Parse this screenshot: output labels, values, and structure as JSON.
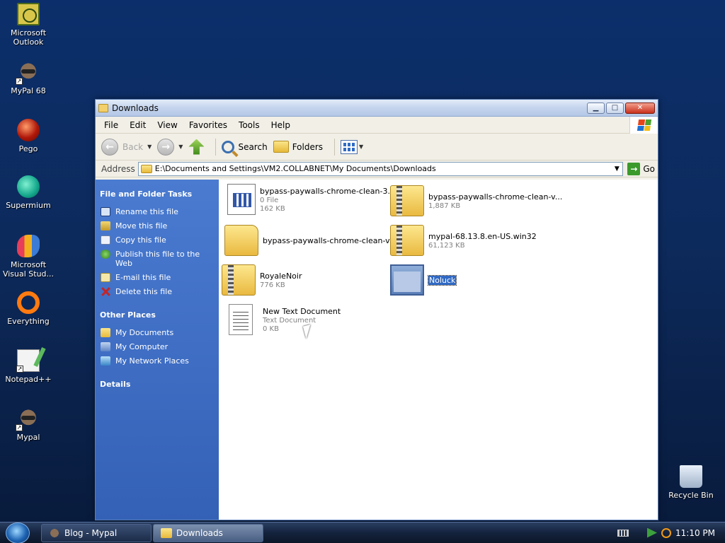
{
  "desktop": {
    "icons": [
      {
        "label": "Microsoft Outlook",
        "icon": "outlook-icon"
      },
      {
        "label": "MyPal 68",
        "icon": "mypal-icon"
      },
      {
        "label": "Pego",
        "icon": "pego-icon"
      },
      {
        "label": "Supermium",
        "icon": "supermium-icon"
      },
      {
        "label": "Microsoft Visual Stud...",
        "icon": "visual-studio-icon"
      },
      {
        "label": "Everything",
        "icon": "everything-icon"
      },
      {
        "label": "Notepad++",
        "icon": "notepadpp-icon"
      },
      {
        "label": "Mypal",
        "icon": "mypal-icon"
      }
    ],
    "recycle_bin": "Recycle Bin"
  },
  "window": {
    "title": "Downloads",
    "menu": [
      "File",
      "Edit",
      "View",
      "Favorites",
      "Tools",
      "Help"
    ],
    "toolbar": {
      "back": "Back",
      "search": "Search",
      "folders": "Folders"
    },
    "address": {
      "label": "Address",
      "path": "E:\\Documents and Settings\\VM2.COLLABNET\\My Documents\\Downloads",
      "go": "Go"
    },
    "taskpane": {
      "file_tasks_title": "File and Folder Tasks",
      "file_tasks": [
        "Rename this file",
        "Move this file",
        "Copy this file",
        "Publish this file to the Web",
        "E-mail this file",
        "Delete this file"
      ],
      "other_places_title": "Other Places",
      "other_places": [
        "My Documents",
        "My Computer",
        "My Network Places"
      ],
      "details_title": "Details"
    },
    "files": [
      {
        "name": "bypass-paywalls-chrome-clean-3....",
        "line1": "0 File",
        "line2": "162 KB",
        "icon": "ini-file-icon"
      },
      {
        "name": "bypass-paywalls-chrome-clean-v...",
        "line1": "1,887 KB",
        "line2": "",
        "icon": "zip-folder-icon"
      },
      {
        "name": "bypass-paywalls-chrome-clean-v...",
        "line1": "",
        "line2": "",
        "icon": "folder-icon"
      },
      {
        "name": "mypal-68.13.8.en-US.win32",
        "line1": "61,123 KB",
        "line2": "",
        "icon": "zip-folder-icon"
      },
      {
        "name": "RoyaleNoir",
        "line1": "776 KB",
        "line2": "",
        "icon": "zip-folder-icon"
      },
      {
        "name": "Noluck",
        "line1": "",
        "line2": "",
        "icon": "application-icon"
      },
      {
        "name": "New Text Document",
        "line1": "Text Document",
        "line2": "0 KB",
        "icon": "text-document-icon"
      }
    ]
  },
  "taskbar": {
    "buttons": [
      "Blog - Mypal",
      "Downloads"
    ],
    "clock": "11:10 PM"
  }
}
